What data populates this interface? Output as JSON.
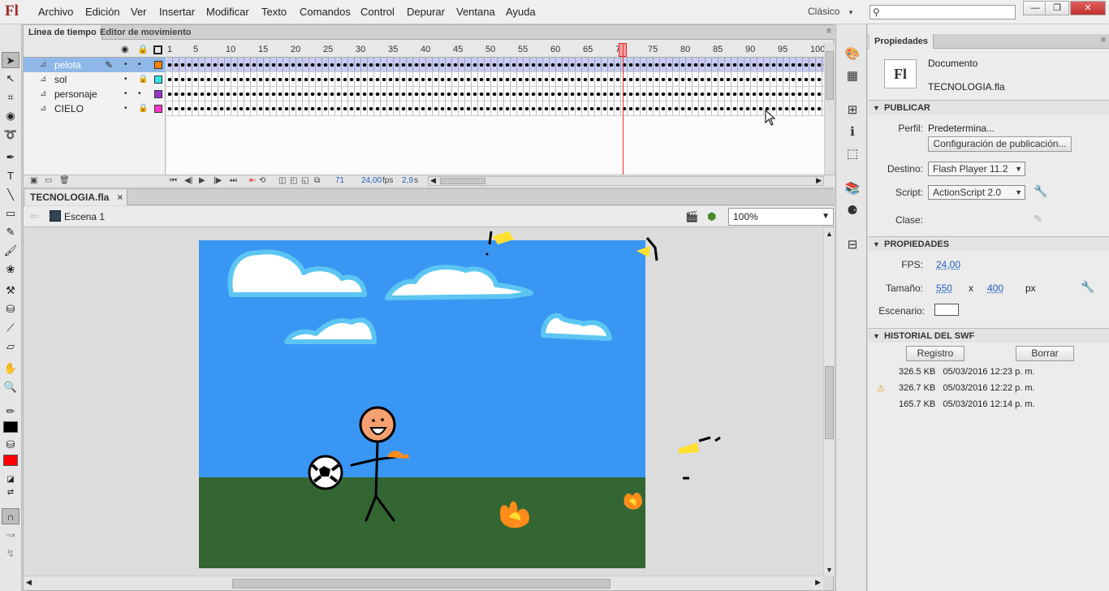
{
  "app": {
    "logo": "Fl",
    "workspace": "Clásico",
    "search_placeholder": ""
  },
  "menu": [
    "Archivo",
    "Edición",
    "Ver",
    "Insertar",
    "Modificar",
    "Texto",
    "Comandos",
    "Control",
    "Depurar",
    "Ventana",
    "Ayuda"
  ],
  "window_controls": {
    "minimize": "—",
    "restore": "❐",
    "close": "✕"
  },
  "timeline": {
    "tabs": [
      "Línea de tiempo",
      "Editor de movimiento"
    ],
    "ruler_ticks": [
      "1",
      "5",
      "10",
      "15",
      "20",
      "25",
      "30",
      "35",
      "40",
      "45",
      "50",
      "55",
      "60",
      "65",
      "70",
      "75",
      "80",
      "85",
      "90",
      "95",
      "100"
    ],
    "layers": [
      {
        "name": "pelota",
        "color": "#ff7f00",
        "locked": false,
        "selected": true
      },
      {
        "name": "sol",
        "color": "#33e6e6",
        "locked": true,
        "selected": false
      },
      {
        "name": "personaje",
        "color": "#9933cc",
        "locked": false,
        "selected": false
      },
      {
        "name": "CIELO",
        "color": "#ff33cc",
        "locked": true,
        "selected": false
      }
    ],
    "current_frame": "71",
    "fps": "24,00",
    "fps_unit": "fps",
    "time": "2,9",
    "time_unit": "s"
  },
  "document": {
    "tab_title": "TECNOLOGIA.fla",
    "tab_close": "×",
    "scene": "Escena 1",
    "zoom": "100%"
  },
  "properties": {
    "tab": "Propiedades",
    "doc_type": "Documento",
    "doc_name": "TECNOLOGIA.fla",
    "doc_thumb": "Fl",
    "publish": {
      "section": "PUBLICAR",
      "profile_label": "Perfil:",
      "profile_value": "Predetermina...",
      "config_button": "Configuración de publicación...",
      "target_label": "Destino:",
      "target_value": "Flash Player 11.2",
      "script_label": "Script:",
      "script_value": "ActionScript 2.0",
      "class_label": "Clase:"
    },
    "props": {
      "section": "PROPIEDADES",
      "fps_label": "FPS:",
      "fps_value": "24,00",
      "size_label": "Tamaño:",
      "width": "550",
      "x": "x",
      "height": "400",
      "unit": "px",
      "stage_label": "Escenario:",
      "stage_color": "#ffffff"
    },
    "history": {
      "section": "HISTORIAL DEL SWF",
      "log_button": "Registro",
      "clear_button": "Borrar",
      "entries": [
        {
          "size": "326.5 KB",
          "date": "05/03/2016 12:23 p. m.",
          "warning": false
        },
        {
          "size": "326.7 KB",
          "date": "05/03/2016 12:22 p. m.",
          "warning": true
        },
        {
          "size": "165.7 KB",
          "date": "05/03/2016 12:14 p. m.",
          "warning": false
        }
      ]
    }
  },
  "colors": {
    "sky": "#3a96f3",
    "grass": "#336633",
    "cloud_outline": "#5cc6f2",
    "fill_color": "#ff0000",
    "stroke_color": "#000000"
  }
}
